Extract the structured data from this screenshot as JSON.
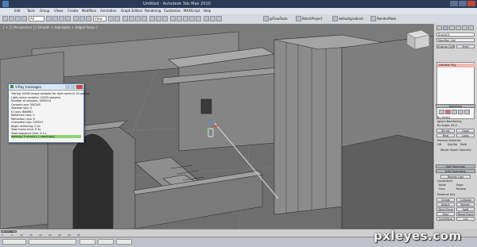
{
  "titlebar": {
    "title": "Untitled - Autodesk 3ds Max 2010"
  },
  "menu": [
    "Edit",
    "Tools",
    "Group",
    "Views",
    "Create",
    "Modifiers",
    "Animation",
    "Graph Editors",
    "Rendering",
    "Customize",
    "MAXScript",
    "Help"
  ],
  "toolbar": {
    "selection_filter": "All",
    "view_dropdown": "View",
    "labels": [
      "giFlowTools",
      "BatchProject",
      "defaultgradient",
      "RenderMask"
    ]
  },
  "viewport": {
    "label": "[ + ] [ Perspective ] [ Smooth + Highlights + Edged Faces ]"
  },
  "message_window": {
    "title": "V-Ray messages",
    "lines": [
      "Tracing 10000 image samples for light cache in 20 passes",
      "Light cache contains 11593 samples",
      "Number of samples: 1899214",
      "Camera rays: 500245",
      "Shadow rays: 0",
      "GI rays: 888661",
      "Reflection rays: 0",
      "Refraction rays: 0",
      "Unshaded rays: 509247",
      "Begin rendering: 0.2s",
      "Total frame time: 0.3s",
      "Total sequence time: 0.3 s",
      "warning: 0 error(s), 1 warning(s)"
    ]
  },
  "panel": {
    "object_name": "Stairs01",
    "modifier_list": "Modifier List",
    "buttons": [
      "Unwrap UVW",
      "Shell"
    ],
    "stack_item": "Editable Poly",
    "rollouts": [
      "Selection",
      "Soft Selection",
      "Edit Geometry"
    ],
    "selection_labels": [
      "By Vertex",
      "Ignore Backfacing",
      "By Angle: 45.0",
      "Shrink",
      "Grow",
      "Ring",
      "Loop",
      "Preview Selection",
      "Off",
      "SubObj",
      "Multi",
      "Whole Object Selected"
    ],
    "edit_geometry": [
      "Repeat Last",
      "Constraints",
      "None",
      "Edge",
      "Face",
      "Normal",
      "Preserve UVs",
      "Create",
      "Collapse",
      "Attach",
      "Detach",
      "Slice Plane",
      "Split",
      "Slice",
      "Reset Plane",
      "QuickSlice",
      "Cut"
    ]
  },
  "timeline": {
    "slider": "0 / 100",
    "ticks": [
      "0",
      "5",
      "10",
      "15",
      "20",
      "25",
      "30",
      "35",
      "40"
    ]
  },
  "watermark": "pxleyes.com"
}
